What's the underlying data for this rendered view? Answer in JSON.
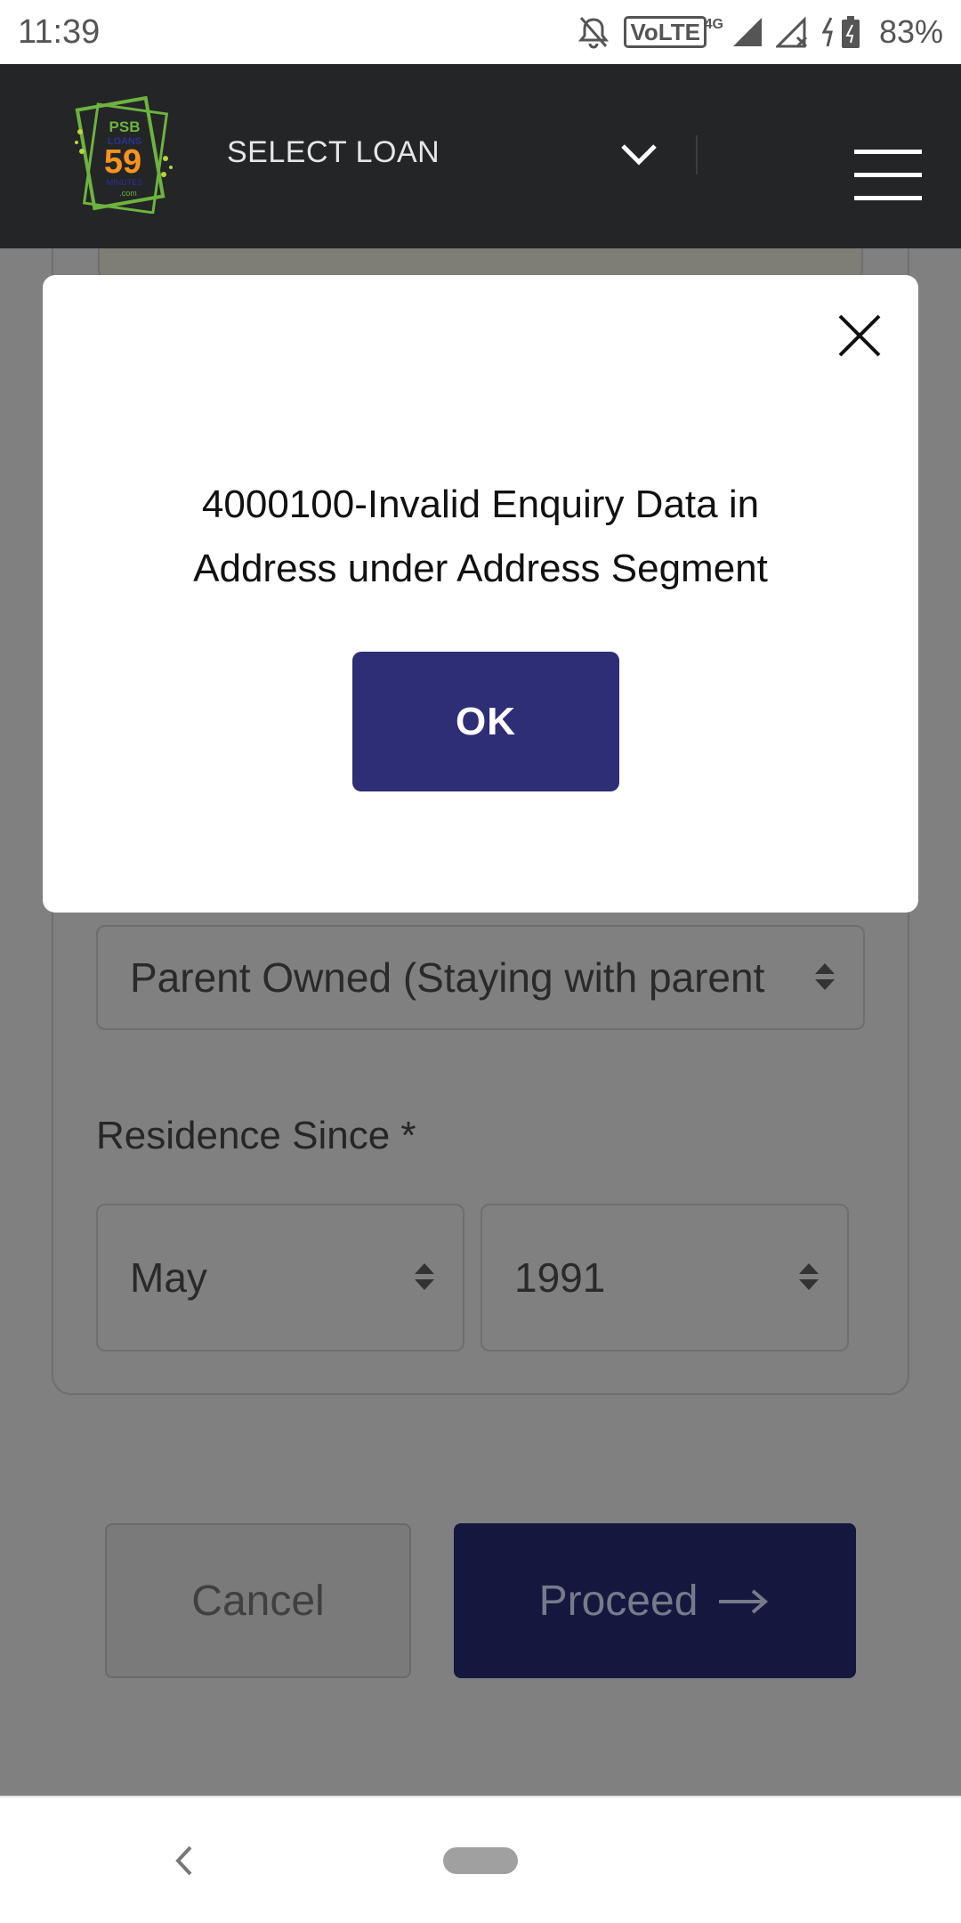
{
  "status_bar": {
    "time": "11:39",
    "network_badge": "VoLTE",
    "network_type": "4G",
    "battery": "83%",
    "icons": [
      "bell-off-icon",
      "signal-icon",
      "signal-x-icon",
      "battery-charging-icon"
    ]
  },
  "header": {
    "logo_lines": [
      "PSB",
      "LOANS",
      "59",
      "MINUTES",
      ".com"
    ],
    "select_loan_label": "SELECT LOAN",
    "icons": [
      "chevron-down-icon",
      "hamburger-menu-icon"
    ]
  },
  "form": {
    "residence_type_value": "Parent Owned (Staying with parent",
    "residence_since_label": "Residence Since *",
    "month_value": "May",
    "year_value": "1991",
    "cancel_label": "Cancel",
    "proceed_label": "Proceed"
  },
  "modal": {
    "message_line1": "4000100-Invalid Enquiry Data in",
    "message_line2": "Address under Address Segment",
    "ok_label": "OK"
  },
  "colors": {
    "header_bg": "#242527",
    "ok_button": "#2e2e77",
    "proceed_button": "#15173f",
    "overlay": "#808080"
  }
}
